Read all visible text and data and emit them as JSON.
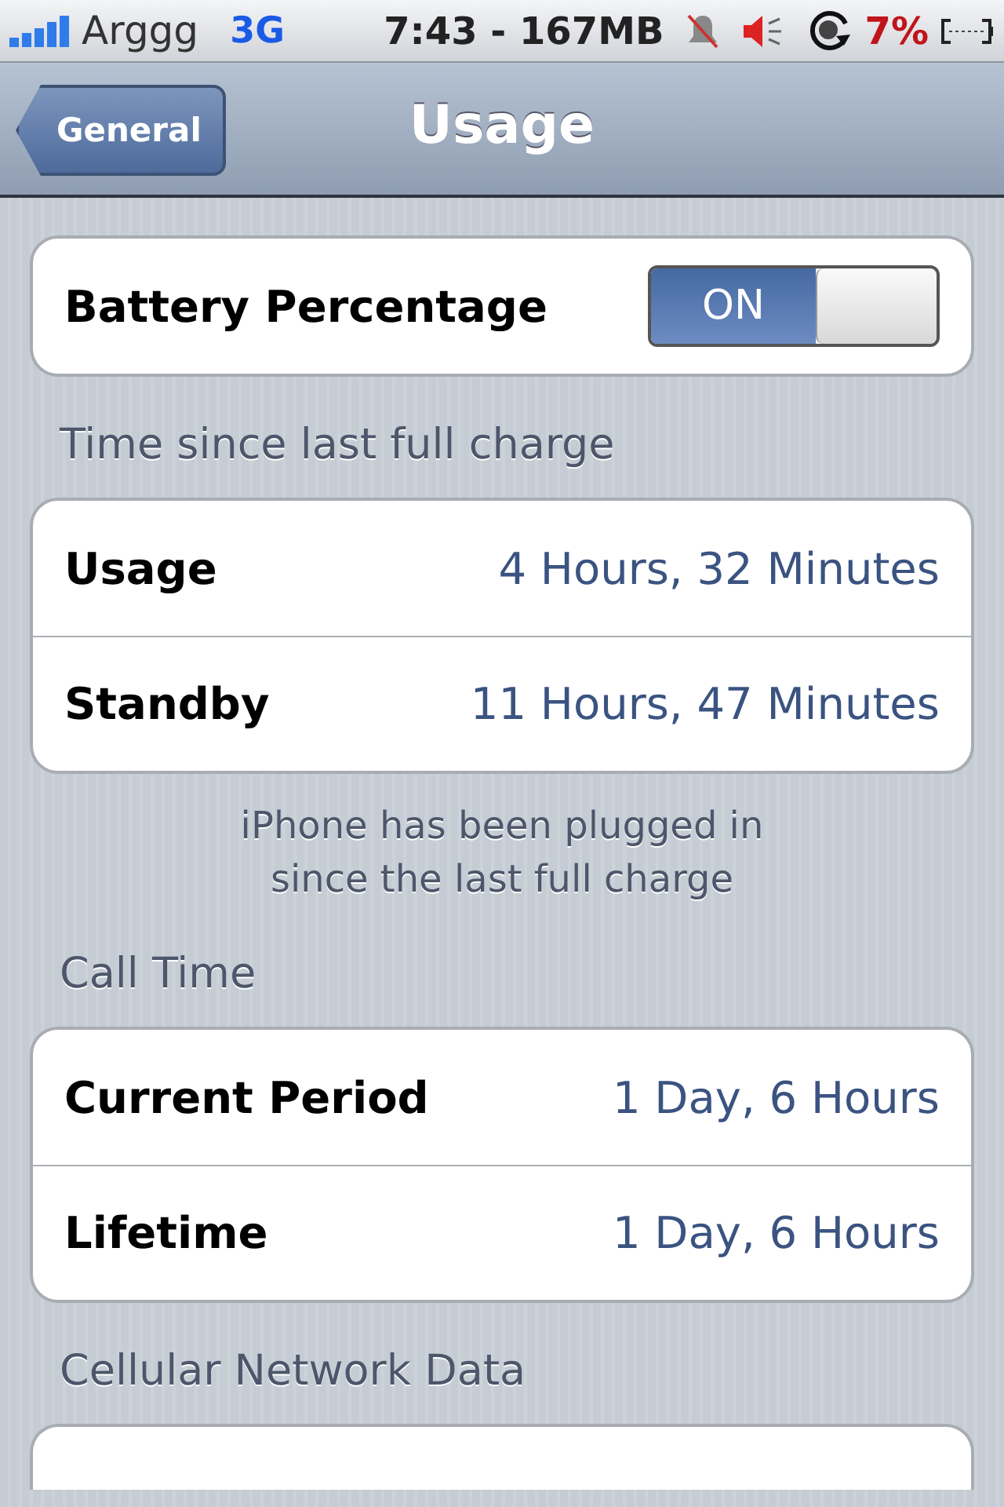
{
  "status_bar": {
    "carrier": "Arggg",
    "network": "3G",
    "time": "7:43 - 167MB",
    "battery_percent": "7%"
  },
  "nav_bar": {
    "back_button": "General",
    "title": "Usage"
  },
  "sections": [
    {
      "rows": [
        {
          "kind": "toggle",
          "label": "Battery Percentage",
          "on": true,
          "on_label": "ON"
        }
      ]
    },
    {
      "header": "Time since last full charge",
      "rows": [
        {
          "kind": "value",
          "label": "Usage",
          "value": "4 Hours, 32 Minutes"
        },
        {
          "kind": "value",
          "label": "Standby",
          "value": "11 Hours, 47 Minutes"
        }
      ],
      "footer": "iPhone has been plugged in\nsince the last full charge"
    },
    {
      "header": "Call Time",
      "rows": [
        {
          "kind": "value",
          "label": "Current Period",
          "value": "1 Day, 6 Hours"
        },
        {
          "kind": "value",
          "label": "Lifetime",
          "value": "1 Day, 6 Hours"
        }
      ]
    },
    {
      "header": "Cellular Network Data"
    }
  ]
}
